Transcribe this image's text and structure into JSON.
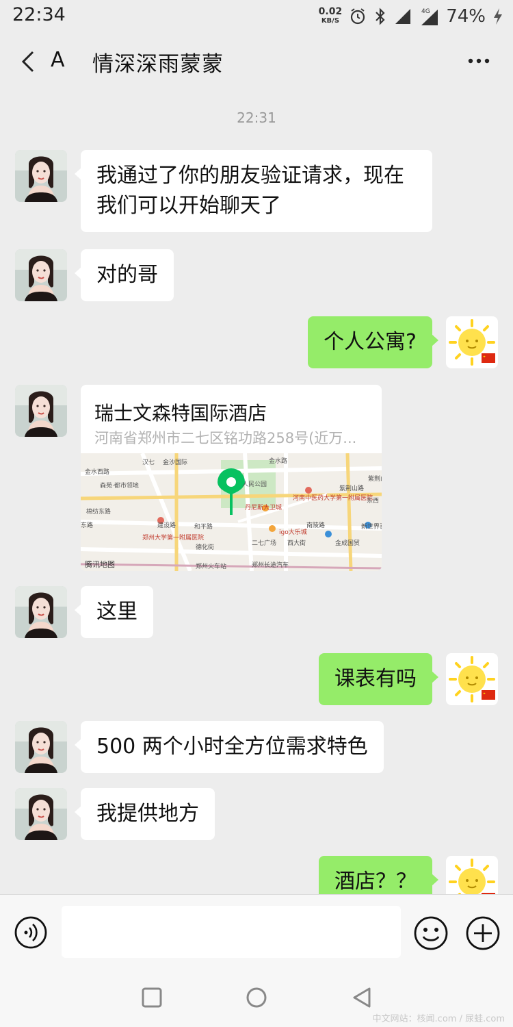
{
  "status_bar": {
    "time": "22:34",
    "speed_value": "0.02",
    "speed_unit": "KB/S",
    "battery": "74%"
  },
  "header": {
    "back_icon": "chevron-left-icon",
    "left_label": "A",
    "title": "情深深雨蒙蒙",
    "more_icon": "more-dots-icon"
  },
  "chat": {
    "timestamp": "22:31",
    "messages": [
      {
        "side": "in",
        "text": "我通过了你的朋友验证请求，现在我们可以开始聊天了"
      },
      {
        "side": "in",
        "text": "对的哥"
      },
      {
        "side": "out",
        "text": "个人公寓?"
      },
      {
        "side": "in",
        "type": "location"
      },
      {
        "side": "in",
        "text": "这里"
      },
      {
        "side": "out",
        "text": "课表有吗"
      },
      {
        "side": "in",
        "text": "500 两个小时全方位需求特色"
      },
      {
        "side": "in",
        "text": "我提供地方"
      },
      {
        "side": "out",
        "text": "酒店？？"
      }
    ],
    "location": {
      "name": "瑞士文森特国际酒店",
      "address": "河南省郑州市二七区铭功路258号(近万...",
      "map_brand": "腾讯地图",
      "map_labels": [
        "汉七",
        "金沙国际",
        "金水路",
        "金水西路",
        "森苑·都市领地",
        "人民公园",
        "河南中医药大学第一附属医院",
        "紫荆山路",
        "丹尼斯大卫城",
        "郑州大学第一附属医院",
        "igo大乐城",
        "二七广场",
        "金成国贸",
        "新世界百货",
        "郑州火车站",
        "郑州长途汽车",
        "西大街",
        "南陵路",
        "建设路",
        "紫荆山",
        "东西",
        "东路",
        "棉纺东路",
        "和平路",
        "德化街"
      ]
    }
  },
  "input_bar": {
    "placeholder": "",
    "voice_icon": "voice-icon",
    "emoji_icon": "emoji-smile-icon",
    "plus_icon": "plus-circle-icon"
  },
  "nav_bar": {
    "icons": [
      "square-icon",
      "circle-icon",
      "triangle-back-icon"
    ]
  },
  "watermark": "中文网站：核闻.com / 尿蛙.com",
  "colors": {
    "background": "#ededed",
    "outgoing_bubble": "#95ec69",
    "incoming_bubble": "#ffffff",
    "map_pin": "#07c160"
  }
}
